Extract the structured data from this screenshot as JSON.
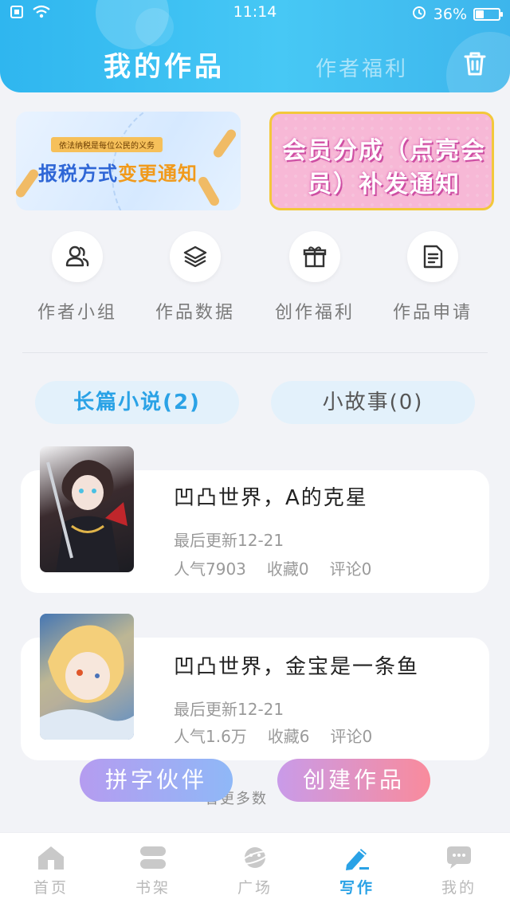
{
  "status_bar": {
    "time": "11:14",
    "battery": "36%",
    "battery_level": 0.36
  },
  "header": {
    "title": "我的作品",
    "author_welfare": "作者福利",
    "trash_icon": "trash-icon"
  },
  "banners": [
    {
      "tag": "依法纳税是每位公民的义务",
      "title_a": "报税方式",
      "title_b": "变更通知"
    },
    {
      "title": "会员分成（点亮会员）补发通知"
    }
  ],
  "features": [
    {
      "label": "作者小组",
      "icon": "group-icon"
    },
    {
      "label": "作品数据",
      "icon": "layers-icon"
    },
    {
      "label": "创作福利",
      "icon": "gift-icon"
    },
    {
      "label": "作品申请",
      "icon": "document-icon"
    }
  ],
  "tabs": {
    "novel": "长篇小说(2)",
    "short_story": "小故事(0)"
  },
  "works": [
    {
      "title": "凹凸世界，A的克星",
      "last_update": "最后更新12-21",
      "popularity": "人气7903",
      "favorites": "收藏0",
      "comments": "评论0"
    },
    {
      "title": "凹凸世界，金宝是一条鱼",
      "last_update": "最后更新12-21",
      "popularity": "人气1.6万",
      "favorites": "收藏6",
      "comments": "评论0"
    }
  ],
  "more_hint": "看更多数",
  "buttons": {
    "partner": "拼字伙伴",
    "create": "创建作品"
  },
  "bottom_nav": [
    {
      "label": "首页",
      "icon": "home-icon"
    },
    {
      "label": "书架",
      "icon": "bookshelf-icon"
    },
    {
      "label": "广场",
      "icon": "planet-icon"
    },
    {
      "label": "写作",
      "icon": "pen-icon",
      "active": true
    },
    {
      "label": "我的",
      "icon": "chat-icon"
    }
  ],
  "colors": {
    "header_gradient_start": "#2fb6ef",
    "accent": "#2aa2e6",
    "tab_bg": "#e3f1fb",
    "page_bg": "#f2f3f7",
    "partner_button_start": "#b59cf0",
    "create_button_end": "#f98b9c"
  }
}
